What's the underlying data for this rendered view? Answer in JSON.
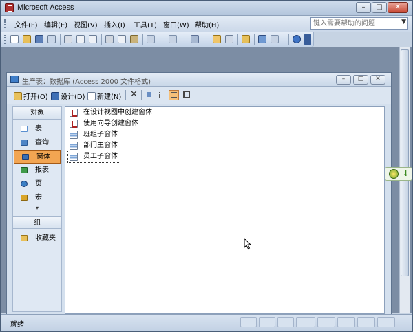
{
  "window": {
    "title": "Microsoft Access",
    "min_glyph": "–",
    "max_glyph": "□",
    "close_glyph": "✕"
  },
  "menu": {
    "items": [
      "文件(F)",
      "编辑(E)",
      "视图(V)",
      "插入(I)",
      "工具(T)",
      "窗口(W)",
      "帮助(H)"
    ],
    "help_placeholder": "键入需要帮助的问题",
    "help_dropdown": "▼"
  },
  "toolbar": {
    "icons": [
      "new-icon",
      "open-icon",
      "save-icon",
      "search-icon",
      "print-icon",
      "print-preview-icon",
      "spelling-icon",
      "cut-icon",
      "copy-icon",
      "paste-icon",
      "undo-icon",
      "office-links-icon",
      "analyze-icon",
      "code-icon",
      "script-icon",
      "properties-icon",
      "relationships-icon",
      "new-object-icon",
      "help-icon"
    ]
  },
  "db_window": {
    "title": "生产表：数据库 (Access 2000 文件格式)",
    "toolbar": {
      "open": "打开(O)",
      "design": "设计(D)",
      "new": "新建(N)",
      "delete_glyph": "✕"
    },
    "objects_header": "对象",
    "objects": [
      {
        "label": "表",
        "icon": "table-icon",
        "color": "#5a8fd0"
      },
      {
        "label": "查询",
        "icon": "query-icon",
        "color": "#4f86c6"
      },
      {
        "label": "窗体",
        "icon": "form-icon",
        "color": "#3a6fb3",
        "selected": true
      },
      {
        "label": "报表",
        "icon": "report-icon",
        "color": "#3f9a49"
      },
      {
        "label": "页",
        "icon": "page-icon",
        "color": "#3b7fc4"
      },
      {
        "label": "宏",
        "icon": "macro-icon",
        "color": "#d9a528"
      }
    ],
    "scroll_glyph": "▾",
    "groups_header": "组",
    "favorites": "收藏夹",
    "list": [
      {
        "label": "在设计视图中创建窗体",
        "icon": "design-wizard-icon",
        "kind": "wiz"
      },
      {
        "label": "使用向导创建窗体",
        "icon": "form-wizard-icon",
        "kind": "wiz"
      },
      {
        "label": "班组子窗体",
        "icon": "form-icon",
        "kind": "form"
      },
      {
        "label": "部门主窗体",
        "icon": "form-icon",
        "kind": "form"
      },
      {
        "label": "员工子窗体",
        "icon": "form-icon",
        "kind": "form",
        "focused": true
      }
    ]
  },
  "status": {
    "text": "就绪"
  },
  "floating_widget": {
    "arrow": "↓"
  }
}
